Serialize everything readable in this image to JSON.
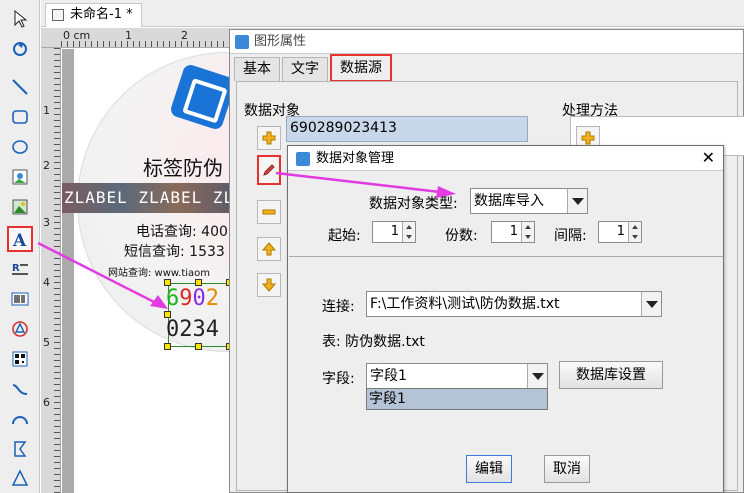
{
  "app": {
    "document_tab": "未命名-1 *"
  },
  "ruler": {
    "h_labels": [
      "0 cm",
      "1",
      "2"
    ],
    "v_labels": [
      "1",
      "2",
      "3",
      "4",
      "5",
      "6"
    ]
  },
  "toolbar": {
    "tools": [
      "pointer-icon",
      "rotate-icon",
      "line-icon",
      "rounded-rect-icon",
      "ellipse-icon",
      "image-icon",
      "picture-icon",
      "text-icon",
      "rich-text-icon",
      "barcode-icon",
      "shape-icon",
      "qrcode-icon",
      "curve-icon",
      "arc-icon",
      "polygon-icon",
      "triangle-icon"
    ],
    "active_tool": "text-icon"
  },
  "label": {
    "title": "标签防伪",
    "strip": "ZLABEL ZLABEL ZL",
    "phone": "电话查询: 400",
    "sms": "短信查询: 1533",
    "web": "网站查询: www.tiaom",
    "code_line1": "6902",
    "code_line2": "0234",
    "code_colors": [
      "#1db31d",
      "#e02828",
      "#8a2be2",
      "#e68a00"
    ]
  },
  "props_window": {
    "title": "图形属性",
    "tabs": [
      "基本",
      "文字",
      "数据源"
    ],
    "selected_tab": "数据源",
    "data_object_label": "数据对象",
    "processing_label": "处理方法",
    "data_object_value": "690289023413",
    "side_buttons": [
      "add-icon",
      "edit-icon",
      "remove-icon",
      "move-up-icon",
      "move-down-icon"
    ]
  },
  "dialog": {
    "title": "数据对象管理",
    "close": "✕",
    "type_label": "数据对象类型:",
    "type_value": "数据库导入",
    "start_label": "起始:",
    "start_value": "1",
    "copies_label": "份数:",
    "copies_value": "1",
    "interval_label": "间隔:",
    "interval_value": "1",
    "connect_label": "连接:",
    "connect_value": "F:\\工作资料\\测试\\防伪数据.txt",
    "table_text": "表: 防伪数据.txt",
    "field_label": "字段:",
    "field_value": "字段1",
    "field_options": [
      "字段1"
    ],
    "db_settings_button": "数据库设置",
    "edit_button": "编辑",
    "cancel_button": "取消"
  },
  "colors": {
    "highlight_red": "#e8312f",
    "arrow_magenta": "#e23be2",
    "selection_blue": "#c8d8ea"
  }
}
